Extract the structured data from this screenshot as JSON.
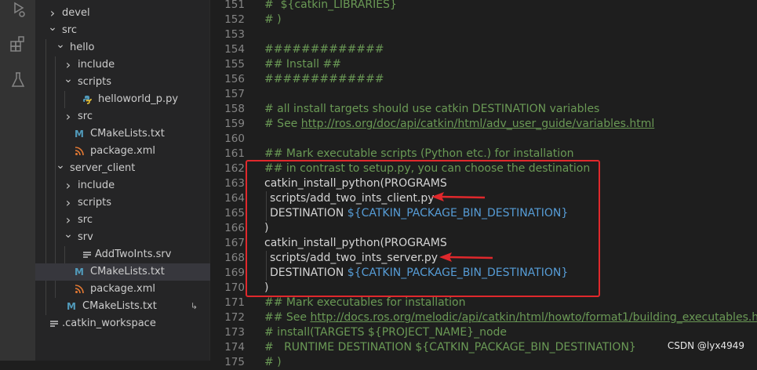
{
  "explorer": {
    "rows": [
      {
        "label": "devel",
        "type": "folder",
        "state": "collapsed",
        "depth": 0
      },
      {
        "label": "src",
        "type": "folder",
        "state": "expanded",
        "depth": 0
      },
      {
        "label": "hello",
        "type": "folder",
        "state": "expanded",
        "depth": 1
      },
      {
        "label": "include",
        "type": "folder",
        "state": "collapsed",
        "depth": 2
      },
      {
        "label": "scripts",
        "type": "folder",
        "state": "expanded",
        "depth": 2
      },
      {
        "label": "helloworld_p.py",
        "type": "python",
        "depth": 3
      },
      {
        "label": "src",
        "type": "folder",
        "state": "collapsed",
        "depth": 2
      },
      {
        "label": "CMakeLists.txt",
        "type": "cmake",
        "icon_text": "M",
        "depth": 2
      },
      {
        "label": "package.xml",
        "type": "xml",
        "depth": 2
      },
      {
        "label": "server_client",
        "type": "folder",
        "state": "expanded",
        "depth": 1
      },
      {
        "label": "include",
        "type": "folder",
        "state": "collapsed",
        "depth": 2
      },
      {
        "label": "scripts",
        "type": "folder",
        "state": "collapsed",
        "depth": 2
      },
      {
        "label": "src",
        "type": "folder",
        "state": "collapsed",
        "depth": 2
      },
      {
        "label": "srv",
        "type": "folder",
        "state": "expanded",
        "depth": 2
      },
      {
        "label": "AddTwoInts.srv",
        "type": "text",
        "depth": 3
      },
      {
        "label": "CMakeLists.txt",
        "type": "cmake",
        "icon_text": "M",
        "depth": 2,
        "selected": true
      },
      {
        "label": "package.xml",
        "type": "xml",
        "depth": 2
      },
      {
        "label": "CMakeLists.txt",
        "type": "cmake",
        "icon_text": "M",
        "depth": 1,
        "badge": "↳"
      },
      {
        "label": ".catkin_workspace",
        "type": "text",
        "depth": 0
      }
    ]
  },
  "editor": {
    "lines": [
      {
        "n": "151",
        "parts": [
          {
            "t": "#  ${catkin_LIBRARIES}",
            "c": "comment"
          }
        ]
      },
      {
        "n": "152",
        "parts": [
          {
            "t": "# )",
            "c": "comment"
          }
        ]
      },
      {
        "n": "153",
        "parts": []
      },
      {
        "n": "154",
        "parts": [
          {
            "t": "#############",
            "c": "comment"
          }
        ]
      },
      {
        "n": "155",
        "parts": [
          {
            "t": "## Install ##",
            "c": "comment"
          }
        ]
      },
      {
        "n": "156",
        "parts": [
          {
            "t": "#############",
            "c": "comment"
          }
        ]
      },
      {
        "n": "157",
        "parts": []
      },
      {
        "n": "158",
        "parts": [
          {
            "t": "# all install targets should use catkin DESTINATION variables",
            "c": "comment"
          }
        ]
      },
      {
        "n": "159",
        "parts": [
          {
            "t": "# See ",
            "c": "comment"
          },
          {
            "t": "http://ros.org/doc/api/catkin/html/adv_user_guide/variables.html",
            "c": "link"
          }
        ]
      },
      {
        "n": "160",
        "parts": []
      },
      {
        "n": "161",
        "parts": [
          {
            "t": "## Mark executable scripts (Python etc.) for installation",
            "c": "comment"
          }
        ]
      },
      {
        "n": "162",
        "parts": [
          {
            "t": "## in contrast to setup.py, you can choose the destination",
            "c": "comment"
          }
        ]
      },
      {
        "n": "163",
        "parts": [
          {
            "t": "catkin_install_python(PROGRAMS",
            "c": "default"
          }
        ]
      },
      {
        "n": "164",
        "indent": true,
        "parts": [
          {
            "t": "scripts/add_two_ints_client.py",
            "c": "default"
          }
        ]
      },
      {
        "n": "165",
        "indent": true,
        "parts": [
          {
            "t": "DESTINATION ",
            "c": "default"
          },
          {
            "t": "${CATKIN_PACKAGE_BIN_DESTINATION}",
            "c": "var"
          }
        ]
      },
      {
        "n": "166",
        "parts": [
          {
            "t": ")",
            "c": "default"
          }
        ]
      },
      {
        "n": "167",
        "parts": [
          {
            "t": "catkin_install_python(PROGRAMS",
            "c": "default"
          }
        ]
      },
      {
        "n": "168",
        "indent": true,
        "parts": [
          {
            "t": "scripts/add_two_ints_server.py",
            "c": "default"
          }
        ]
      },
      {
        "n": "169",
        "indent": true,
        "parts": [
          {
            "t": "DESTINATION ",
            "c": "default"
          },
          {
            "t": "${CATKIN_PACKAGE_BIN_DESTINATION}",
            "c": "var"
          }
        ]
      },
      {
        "n": "170",
        "parts": [
          {
            "t": ")",
            "c": "default"
          }
        ]
      },
      {
        "n": "171",
        "parts": [
          {
            "t": "## Mark executables for installation",
            "c": "comment"
          }
        ]
      },
      {
        "n": "172",
        "parts": [
          {
            "t": "## See ",
            "c": "comment"
          },
          {
            "t": "http://docs.ros.org/melodic/api/catkin/html/howto/format1/building_executables.html",
            "c": "link"
          }
        ]
      },
      {
        "n": "173",
        "parts": [
          {
            "t": "# install(TARGETS ${PROJECT_NAME}_node",
            "c": "comment"
          }
        ]
      },
      {
        "n": "174",
        "parts": [
          {
            "t": "#   RUNTIME DESTINATION ${CATKIN_PACKAGE_BIN_DESTINATION}",
            "c": "comment"
          }
        ]
      },
      {
        "n": "175",
        "parts": [
          {
            "t": "# )",
            "c": "comment"
          }
        ]
      }
    ]
  },
  "colors": {
    "highlight": "#e0282c",
    "comment": "#6a9955",
    "variable": "#569cd6",
    "text": "#d4d4d4"
  },
  "watermark": "CSDN @lyx4949"
}
